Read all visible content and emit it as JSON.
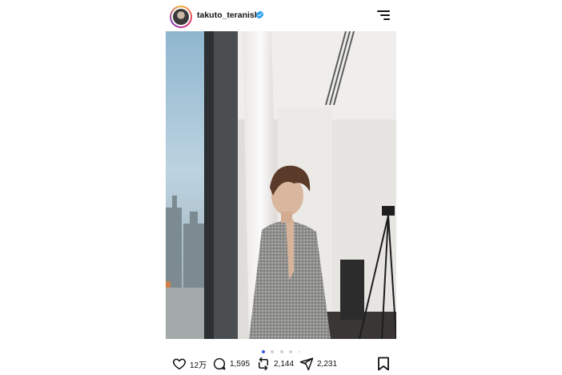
{
  "post": {
    "username": "takuto_teranishi",
    "verified": true
  },
  "photo": {
    "description_icon": "photo-image"
  },
  "carousel": {
    "total_dots": 5,
    "active_index": 0
  },
  "actions": {
    "like_count": "12万",
    "comment_count": "1,595",
    "repost_count": "2,144",
    "share_count": "2,231"
  },
  "colors": {
    "accent": "#3b5bdb",
    "verified": "#1d9bf0"
  }
}
